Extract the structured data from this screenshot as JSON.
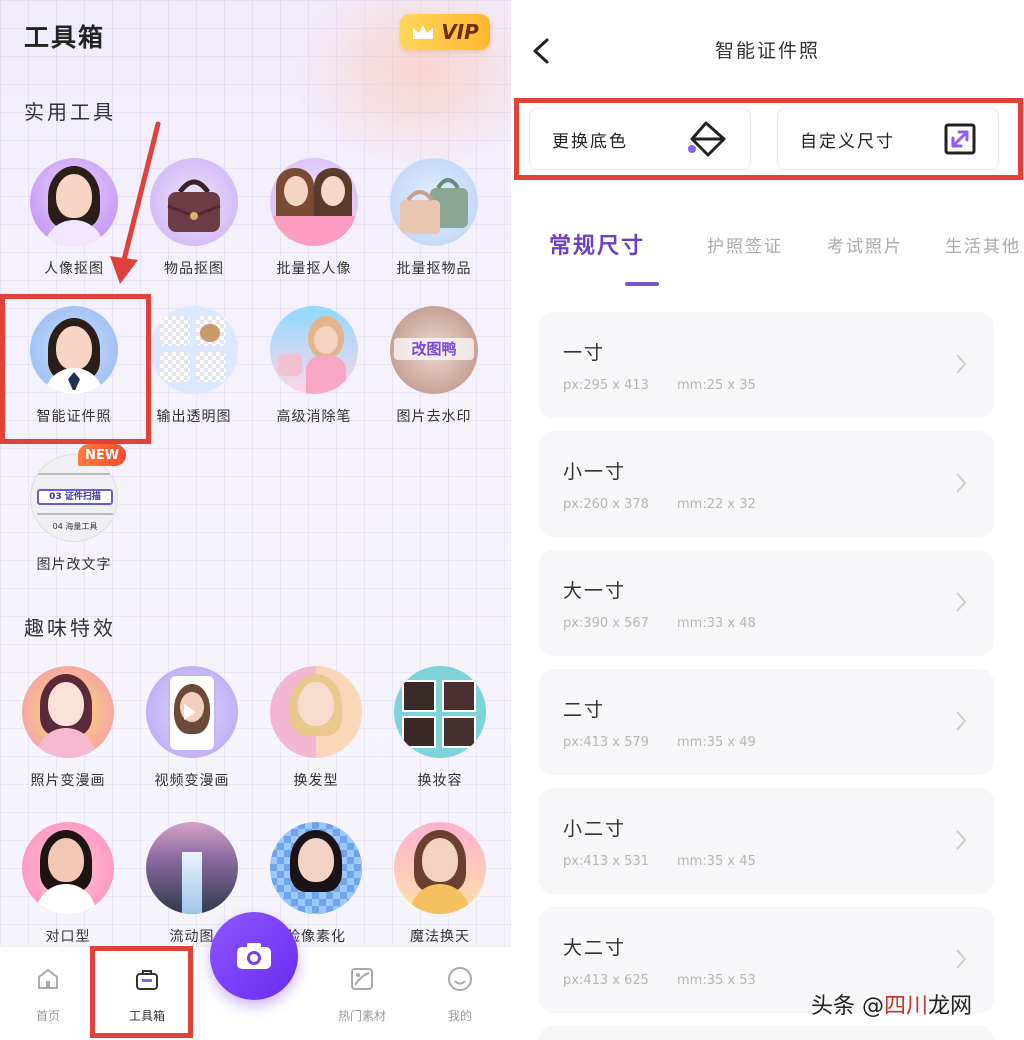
{
  "left": {
    "app_title": "工具箱",
    "vip_label": "VIP",
    "sections": {
      "practical": "实用工具",
      "fun": "趣味特效"
    },
    "tools_practical": [
      {
        "label": "人像抠图",
        "icon": "portrait-cutout-icon"
      },
      {
        "label": "物品抠图",
        "icon": "bag-cutout-icon"
      },
      {
        "label": "批量抠人像",
        "icon": "batch-portrait-icon"
      },
      {
        "label": "批量抠物品",
        "icon": "batch-items-icon"
      },
      {
        "label": "智能证件照",
        "icon": "id-photo-icon"
      },
      {
        "label": "输出透明图",
        "icon": "transparent-output-icon"
      },
      {
        "label": "高级消除笔",
        "icon": "eraser-pen-icon"
      },
      {
        "label": "图片去水印",
        "icon": "watermark-remove-icon"
      },
      {
        "label": "图片改文字",
        "icon": "edit-text-icon"
      }
    ],
    "new_badge": "NEW",
    "tools_fun": [
      {
        "label": "照片变漫画",
        "icon": "photo-to-comic-icon"
      },
      {
        "label": "视频变漫画",
        "icon": "video-to-comic-icon"
      },
      {
        "label": "换发型",
        "icon": "hairstyle-icon"
      },
      {
        "label": "换妆容",
        "icon": "makeup-icon"
      },
      {
        "label": "对口型",
        "icon": "lipsync-icon"
      },
      {
        "label": "流动图",
        "icon": "flow-image-icon"
      },
      {
        "label": "脸像素化",
        "icon": "pixelate-face-icon"
      },
      {
        "label": "魔法换天",
        "icon": "sky-replace-icon"
      }
    ],
    "bottom_nav": [
      {
        "label": "首页",
        "icon": "home-icon"
      },
      {
        "label": "工具箱",
        "icon": "toolbox-icon"
      },
      {
        "label": "热门素材",
        "icon": "materials-icon"
      },
      {
        "label": "我的",
        "icon": "profile-icon"
      }
    ]
  },
  "right": {
    "page_title": "智能证件照",
    "actions": [
      {
        "label": "更换底色",
        "icon": "paint-bucket-icon"
      },
      {
        "label": "自定义尺寸",
        "icon": "resize-icon"
      }
    ],
    "tabs": [
      "常规尺寸",
      "护照签证",
      "考试照片",
      "生活其他"
    ],
    "sizes": [
      {
        "name": "一寸",
        "px": "px:295 x 413",
        "mm": "mm:25 x 35"
      },
      {
        "name": "小一寸",
        "px": "px:260 x 378",
        "mm": "mm:22 x 32"
      },
      {
        "name": "大一寸",
        "px": "px:390 x 567",
        "mm": "mm:33 x 48"
      },
      {
        "name": "二寸",
        "px": "px:413 x 579",
        "mm": "mm:35 x 49"
      },
      {
        "name": "小二寸",
        "px": "px:413 x 531",
        "mm": "mm:35 x 45"
      },
      {
        "name": "大二寸",
        "px": "px:413 x 625",
        "mm": "mm:35 x 53"
      }
    ]
  },
  "watermark": {
    "prefix": "头条 @",
    "highlight": "四川",
    "suffix": "龙网"
  },
  "colors": {
    "accent": "#6c3fc7",
    "highlight_box": "#e0423a",
    "vip": "#ffc53d"
  }
}
